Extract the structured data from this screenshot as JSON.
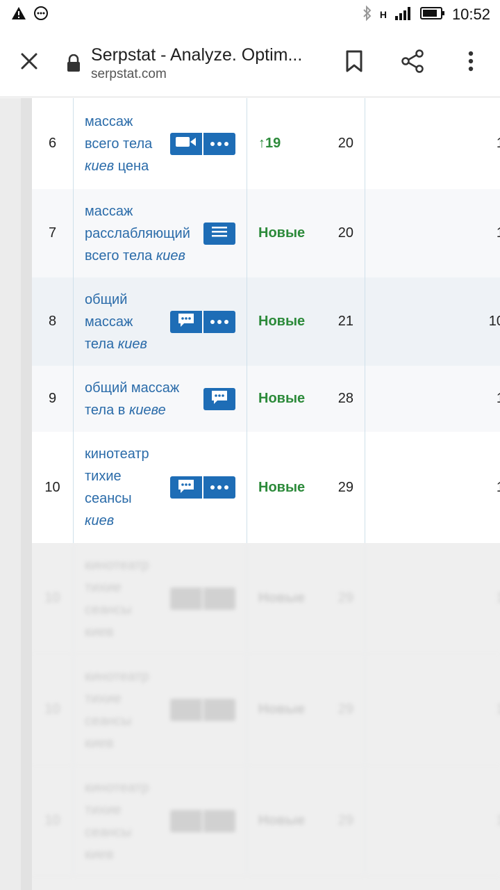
{
  "status_bar": {
    "network_label": "H",
    "time": "10:52"
  },
  "toolbar": {
    "title": "Serpstat - Analyze. Optim...",
    "url": "serpstat.com"
  },
  "rows": [
    {
      "num": "6",
      "kw_parts": [
        "массаж",
        "всего тела",
        "киев",
        "цена"
      ],
      "change": "19",
      "change_arrow": "↑",
      "pos": "20",
      "vol": "1",
      "buttons": "video-more"
    },
    {
      "num": "7",
      "kw_parts": [
        "массаж",
        "расслабляющий",
        "всего тела",
        "киев"
      ],
      "change": "Новые",
      "pos": "20",
      "vol": "1",
      "buttons": "list"
    },
    {
      "num": "8",
      "kw_parts": [
        "общий",
        "массаж",
        "тела",
        "киев"
      ],
      "change": "Новые",
      "pos": "21",
      "vol": "10",
      "buttons": "chat-more"
    },
    {
      "num": "9",
      "kw_parts": [
        "общий массаж",
        "тела в",
        "киеве"
      ],
      "change": "Новые",
      "pos": "28",
      "vol": "1",
      "buttons": "chat"
    },
    {
      "num": "10",
      "kw_parts": [
        "кинотеатр",
        "тихие",
        "сеансы",
        "киев"
      ],
      "change": "Новые",
      "pos": "29",
      "vol": "1",
      "buttons": "chat-more"
    }
  ],
  "blurred_rows": [
    {
      "num": "10",
      "kw_parts": [
        "кинотеатр",
        "тихие",
        "сеансы",
        "киев"
      ],
      "change": "Новые",
      "pos": "29",
      "vol": "1"
    },
    {
      "num": "10",
      "kw_parts": [
        "кинотеатр",
        "тихие",
        "сеансы",
        "киев"
      ],
      "change": "Новые",
      "pos": "29",
      "vol": "1"
    },
    {
      "num": "10",
      "kw_parts": [
        "кинотеатр",
        "тихие",
        "сеансы",
        "киев"
      ],
      "change": "Новые",
      "pos": "29",
      "vol": "1"
    }
  ],
  "colors": {
    "link": "#2a6ba9",
    "button": "#1e6db6",
    "positive": "#2c8a3a"
  }
}
